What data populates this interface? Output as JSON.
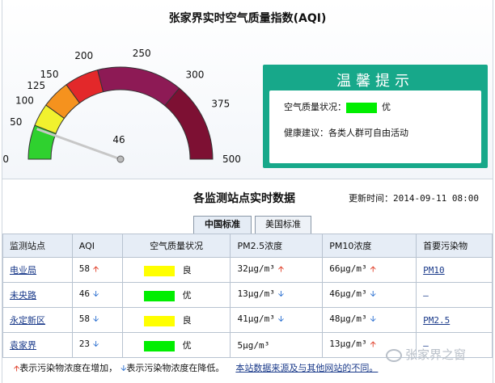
{
  "title": "张家界实时空气质量指数(AQI)",
  "gauge": {
    "value": 46,
    "min": 0,
    "max": 500,
    "ticks": [
      "0",
      "50",
      "100",
      "125",
      "150",
      "200",
      "250",
      "300",
      "375",
      "500"
    ],
    "value_label": "46",
    "band_colors": [
      "#2fd12f",
      "#f1f12e",
      "#f5921e",
      "#e3282a",
      "#8d1a55",
      "#7d1033"
    ]
  },
  "tips": {
    "title": "温馨提示",
    "quality_label": "空气质量状况：",
    "quality_value": "优",
    "quality_color": "#00ee00",
    "advice_label": "健康建议：",
    "advice_text": "各类人群可自由活动"
  },
  "stations_section": {
    "title": "各监测站点实时数据",
    "update_label": "更新时间：",
    "update_time": "2014-09-11 08:00"
  },
  "tabs": [
    {
      "label": "中国标准",
      "active": true
    },
    {
      "label": "美国标准",
      "active": false
    }
  ],
  "table": {
    "headers": [
      "监测站点",
      "AQI",
      "空气质量状况",
      "PM2.5浓度",
      "PM10浓度",
      "首要污染物"
    ],
    "rows": [
      {
        "station": "电业局",
        "aqi": "58",
        "aqi_trend": "up",
        "quality": "良",
        "quality_color": "#ffff00",
        "pm25": "32μg/m³",
        "pm25_trend": "up",
        "pm10": "66μg/m³",
        "pm10_trend": "up",
        "primary": "PM10"
      },
      {
        "station": "未央路",
        "aqi": "46",
        "aqi_trend": "down",
        "quality": "优",
        "quality_color": "#00ee00",
        "pm25": "13μg/m³",
        "pm25_trend": "down",
        "pm10": "46μg/m³",
        "pm10_trend": "down",
        "primary": "—"
      },
      {
        "station": "永定新区",
        "aqi": "58",
        "aqi_trend": "down",
        "quality": "良",
        "quality_color": "#ffff00",
        "pm25": "41μg/m³",
        "pm25_trend": "down",
        "pm10": "48μg/m³",
        "pm10_trend": "down",
        "primary": "PM2.5"
      },
      {
        "station": "袁家界",
        "aqi": "23",
        "aqi_trend": "down",
        "quality": "优",
        "quality_color": "#00ee00",
        "pm25": "5μg/m³",
        "pm25_trend": "",
        "pm10": "13μg/m³",
        "pm10_trend": "up",
        "primary": "—"
      }
    ]
  },
  "footer": {
    "up_text": "表示污染物浓度在增加，",
    "down_text": "表示污染物浓度在降低。",
    "link_text": "本站数据来源及与其他网站的不同。"
  },
  "watermark": "张家界之窗",
  "icons": {
    "up": "arrow-up-icon",
    "down": "arrow-down-icon"
  }
}
